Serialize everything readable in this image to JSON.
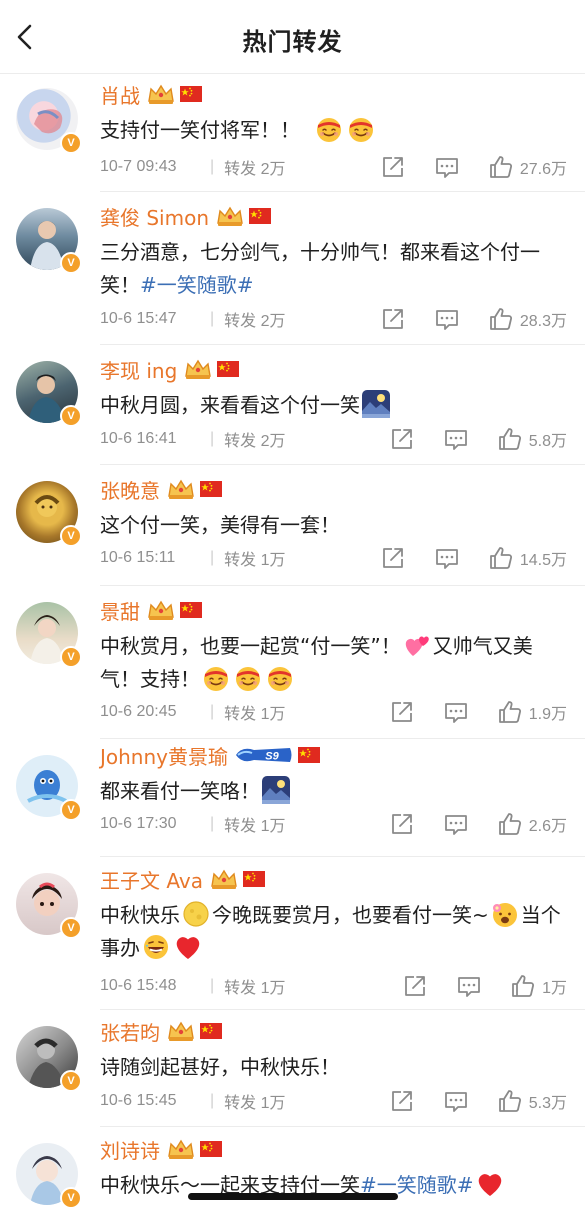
{
  "header": {
    "title": "热门转发",
    "back_icon": "chevron-left-icon"
  },
  "colors": {
    "name": "#e8762b",
    "tag": "#3c6fb5",
    "meta": "#8f8f8f",
    "badge": "#f4a02a"
  },
  "posts": [
    {
      "name": "肖战",
      "badges": [
        "crown-icon",
        "china-flag-icon"
      ],
      "text_parts": [
        "支持付一笑付将军！！"
      ],
      "emojis": [
        "smile-headband-emoji",
        "smile-headband-emoji"
      ],
      "time": "10-7 09:43",
      "forward": "转发 2万",
      "likes": "27.6万"
    },
    {
      "name": "龚俊 Simon",
      "badges": [
        "crown-icon",
        "china-flag-icon"
      ],
      "text_parts": [
        "三分酒意，七分剑气，十分帅气！都来看这个付一笑！",
        "#一笑随歌#"
      ],
      "time": "10-6 15:47",
      "forward": "转发 2万",
      "likes": "28.3万"
    },
    {
      "name": "李现 ing",
      "badges": [
        "crown-icon",
        "china-flag-icon"
      ],
      "text_parts": [
        "中秋月圆，来看看这个付一笑"
      ],
      "emojis": [
        "moon-viewing-emoji"
      ],
      "time": "10-6 16:41",
      "forward": "转发 2万",
      "likes": "5.8万"
    },
    {
      "name": "张晚意",
      "badges": [
        "crown-icon",
        "china-flag-icon"
      ],
      "text_parts": [
        "这个付一笑，美得有一套！"
      ],
      "time": "10-6 15:11",
      "forward": "转发 1万",
      "likes": "14.5万"
    },
    {
      "name": "景甜",
      "badges": [
        "crown-icon",
        "china-flag-icon"
      ],
      "text_parts": [
        "中秋赏月，也要一起赏“付一笑”！",
        "又帅气又美气！支持！"
      ],
      "emojis": [
        "hearts-emoji",
        "smile-headband-emoji",
        "smile-headband-emoji",
        "smile-headband-emoji"
      ],
      "time": "10-6 20:45",
      "forward": "转发 1万",
      "likes": "1.9万"
    },
    {
      "name": "Johnny黄景瑜",
      "badges": [
        "vip-s9-badge",
        "china-flag-icon"
      ],
      "badge_text": "S9",
      "text_parts": [
        "都来看付一笑咯！"
      ],
      "emojis": [
        "moon-viewing-emoji"
      ],
      "time": "10-6 17:30",
      "forward": "转发 1万",
      "likes": "2.6万"
    },
    {
      "name": "王子文 Ava",
      "badges": [
        "crown-icon",
        "china-flag-icon"
      ],
      "text_parts": [
        "中秋快乐",
        "今晚既要赏月，也要看付一笑~",
        "当个事办"
      ],
      "emojis": [
        "full-moon-emoji",
        "flower-face-emoji",
        "laughing-emoji",
        "red-heart-emoji"
      ],
      "time": "10-6 15:48",
      "forward": "转发 1万",
      "likes": "1万"
    },
    {
      "name": "张若昀",
      "badges": [
        "crown-icon",
        "china-flag-icon"
      ],
      "text_parts": [
        "诗随剑起甚好，中秋快乐！"
      ],
      "time": "10-6 15:45",
      "forward": "转发 1万",
      "likes": "5.3万"
    },
    {
      "name": "刘诗诗",
      "badges": [
        "crown-icon",
        "china-flag-icon"
      ],
      "text_parts": [
        "中秋快乐～一起来支持付一笑",
        "#一笑随歌#"
      ],
      "emojis": [
        "red-heart-emoji"
      ]
    }
  ]
}
